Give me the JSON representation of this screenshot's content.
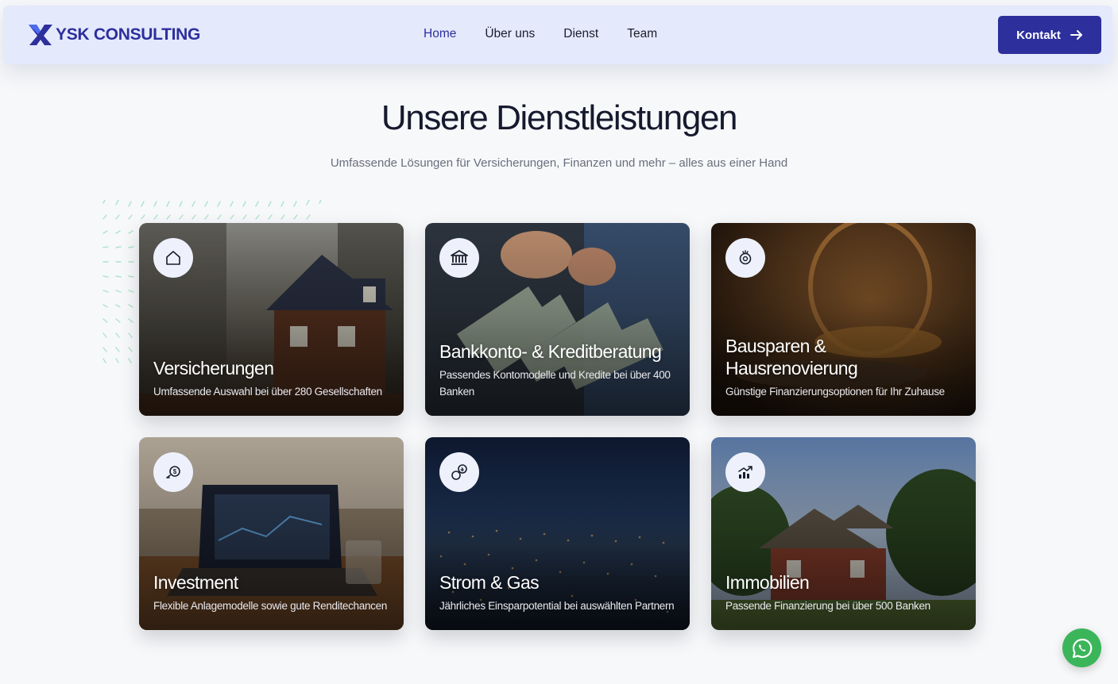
{
  "brand": {
    "name": "YSK CONSULTING",
    "color": "#2d2f9c"
  },
  "nav": {
    "items": [
      {
        "label": "Home",
        "active": true
      },
      {
        "label": "Über uns",
        "active": false
      },
      {
        "label": "Dienst",
        "active": false
      },
      {
        "label": "Team",
        "active": false
      }
    ],
    "cta_label": "Kontakt"
  },
  "section": {
    "title": "Unsere Dienstleistungen",
    "subtitle": "Umfassende Lösungen für Versicherungen, Finanzen und mehr – alles aus einer Hand"
  },
  "services": [
    {
      "title": "Versicherungen",
      "description": "Umfassende Auswahl bei über 280 Gesellschaften",
      "icon": "home-icon"
    },
    {
      "title": "Bankkonto- & Kreditberatung",
      "description": "Passendes Kontomodelle und Kredite bei über 400 Banken",
      "icon": "bank-icon"
    },
    {
      "title": "Bausparen & Hausrenovierung",
      "description": "Günstige Finanzierungsoptionen für Ihr Zuhause",
      "icon": "piggy-bank-icon"
    },
    {
      "title": "Investment",
      "description": "Flexible Anlagemodelle sowie gute Renditechancen",
      "icon": "investment-icon"
    },
    {
      "title": "Strom & Gas",
      "description": "Jährliches Einsparpotential bei auswählten Partnern",
      "icon": "energy-icon"
    },
    {
      "title": "Immobilien",
      "description": "Passende Finanzierung bei über 500 Banken",
      "icon": "chart-icon"
    }
  ],
  "colors": {
    "accent": "#2d2f9c",
    "whatsapp": "#3bb55a",
    "nav_bg": "#e4e9fc"
  },
  "floating": {
    "icon": "whatsapp-icon"
  }
}
